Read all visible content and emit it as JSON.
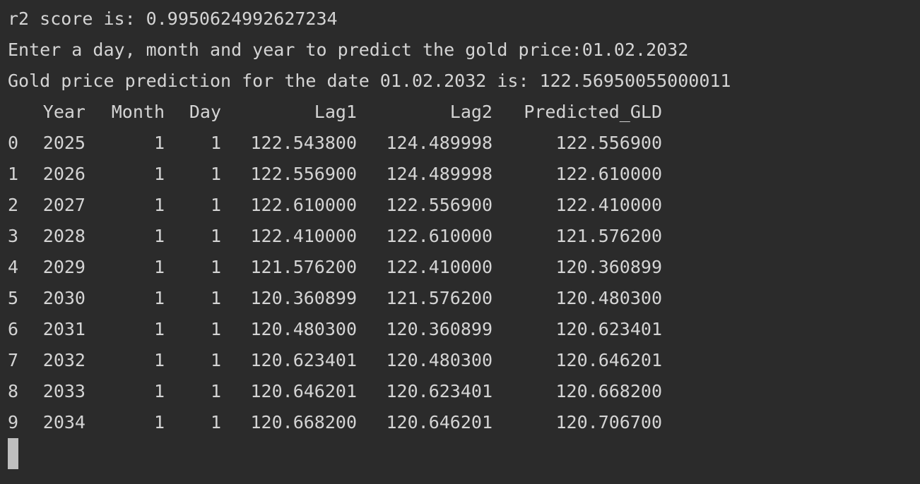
{
  "output": {
    "r2_line": "r2 score is: 0.9950624992627234",
    "prompt_line": "Enter a day, month and year to predict the gold price:01.02.2032",
    "prediction_line": "Gold price prediction for the date 01.02.2032 is: 122.56950055000011"
  },
  "table": {
    "headers": {
      "year": "Year",
      "month": "Month",
      "day": "Day",
      "lag1": "Lag1",
      "lag2": "Lag2",
      "pred": "Predicted_GLD"
    },
    "rows": [
      {
        "idx": "0",
        "year": "2025",
        "month": "1",
        "day": "1",
        "lag1": "122.543800",
        "lag2": "124.489998",
        "pred": "122.556900"
      },
      {
        "idx": "1",
        "year": "2026",
        "month": "1",
        "day": "1",
        "lag1": "122.556900",
        "lag2": "124.489998",
        "pred": "122.610000"
      },
      {
        "idx": "2",
        "year": "2027",
        "month": "1",
        "day": "1",
        "lag1": "122.610000",
        "lag2": "122.556900",
        "pred": "122.410000"
      },
      {
        "idx": "3",
        "year": "2028",
        "month": "1",
        "day": "1",
        "lag1": "122.410000",
        "lag2": "122.610000",
        "pred": "121.576200"
      },
      {
        "idx": "4",
        "year": "2029",
        "month": "1",
        "day": "1",
        "lag1": "121.576200",
        "lag2": "122.410000",
        "pred": "120.360899"
      },
      {
        "idx": "5",
        "year": "2030",
        "month": "1",
        "day": "1",
        "lag1": "120.360899",
        "lag2": "121.576200",
        "pred": "120.480300"
      },
      {
        "idx": "6",
        "year": "2031",
        "month": "1",
        "day": "1",
        "lag1": "120.480300",
        "lag2": "120.360899",
        "pred": "120.623401"
      },
      {
        "idx": "7",
        "year": "2032",
        "month": "1",
        "day": "1",
        "lag1": "120.623401",
        "lag2": "120.480300",
        "pred": "120.646201"
      },
      {
        "idx": "8",
        "year": "2033",
        "month": "1",
        "day": "1",
        "lag1": "120.646201",
        "lag2": "120.623401",
        "pred": "120.668200"
      },
      {
        "idx": "9",
        "year": "2034",
        "month": "1",
        "day": "1",
        "lag1": "120.668200",
        "lag2": "120.646201",
        "pred": "120.706700"
      }
    ]
  },
  "colors": {
    "background": "#2b2b2b",
    "text": "#d4d4d4",
    "cursor": "#bfbfbf"
  }
}
